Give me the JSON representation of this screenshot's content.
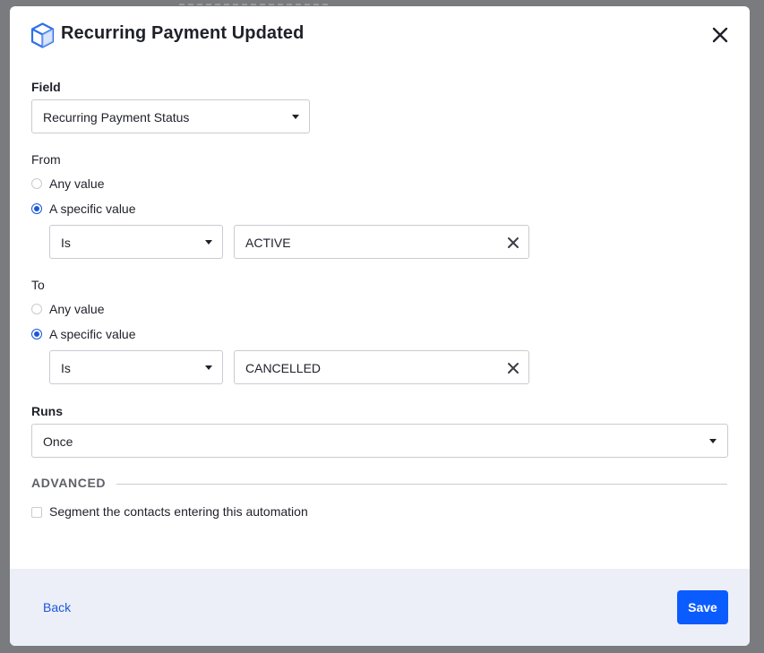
{
  "modal": {
    "title": "Recurring Payment Updated",
    "icon": "cube-icon",
    "accent_color": "#1a56db"
  },
  "field": {
    "label": "Field",
    "selected": "Recurring Payment Status"
  },
  "from": {
    "label": "From",
    "options": [
      {
        "label": "Any value",
        "selected": false
      },
      {
        "label": "A specific value",
        "selected": true
      }
    ],
    "operator": "Is",
    "value": "ACTIVE"
  },
  "to": {
    "label": "To",
    "options": [
      {
        "label": "Any value",
        "selected": false
      },
      {
        "label": "A specific value",
        "selected": true
      }
    ],
    "operator": "Is",
    "value": "CANCELLED"
  },
  "runs": {
    "label": "Runs",
    "selected": "Once"
  },
  "advanced": {
    "heading": "ADVANCED",
    "segment_label": "Segment the contacts entering this automation",
    "segment_checked": false
  },
  "footer": {
    "back_label": "Back",
    "save_label": "Save",
    "save_color": "#0a5cff"
  }
}
